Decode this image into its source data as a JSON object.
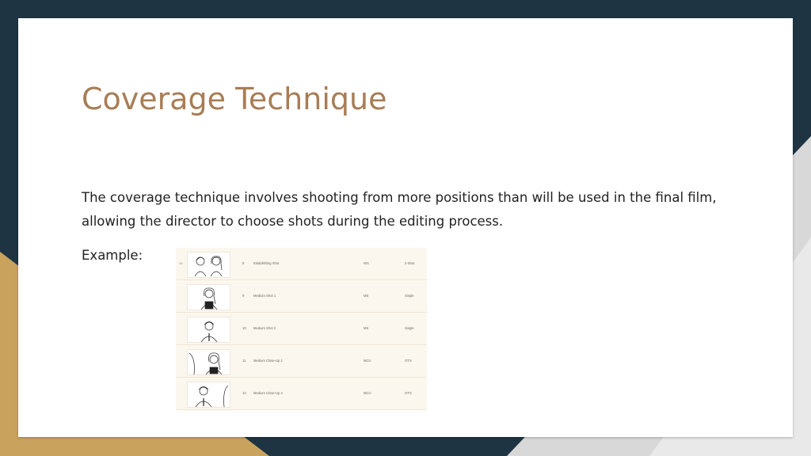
{
  "slide": {
    "title": "Coverage Technique",
    "body": "The coverage technique involves shooting from more positions than will be used in the final film, allowing the director to choose shots during the editing process.",
    "example_label": "Example:"
  },
  "table": {
    "lead_label": "10",
    "rows": [
      {
        "num": "8",
        "name": "Establishing Shot",
        "size": "WS",
        "type": "2-Shot",
        "figures": "two-people"
      },
      {
        "num": "9",
        "name": "Medium Shot 1",
        "size": "MS",
        "type": "Single",
        "figures": "woman"
      },
      {
        "num": "10",
        "name": "Medium Shot 2",
        "size": "MS",
        "type": "Single",
        "figures": "man"
      },
      {
        "num": "11",
        "name": "Medium Close-Up 1",
        "size": "MCU",
        "type": "OTS",
        "figures": "woman-over-shoulder"
      },
      {
        "num": "12",
        "name": "Medium Close-Up 2",
        "size": "MCU",
        "type": "OTS",
        "figures": "man-over-shoulder"
      }
    ]
  },
  "colors": {
    "background_dark": "#1f3442",
    "background_gold": "#c9a35d",
    "title": "#a87d56",
    "table_bg": "#fcf7ee"
  }
}
